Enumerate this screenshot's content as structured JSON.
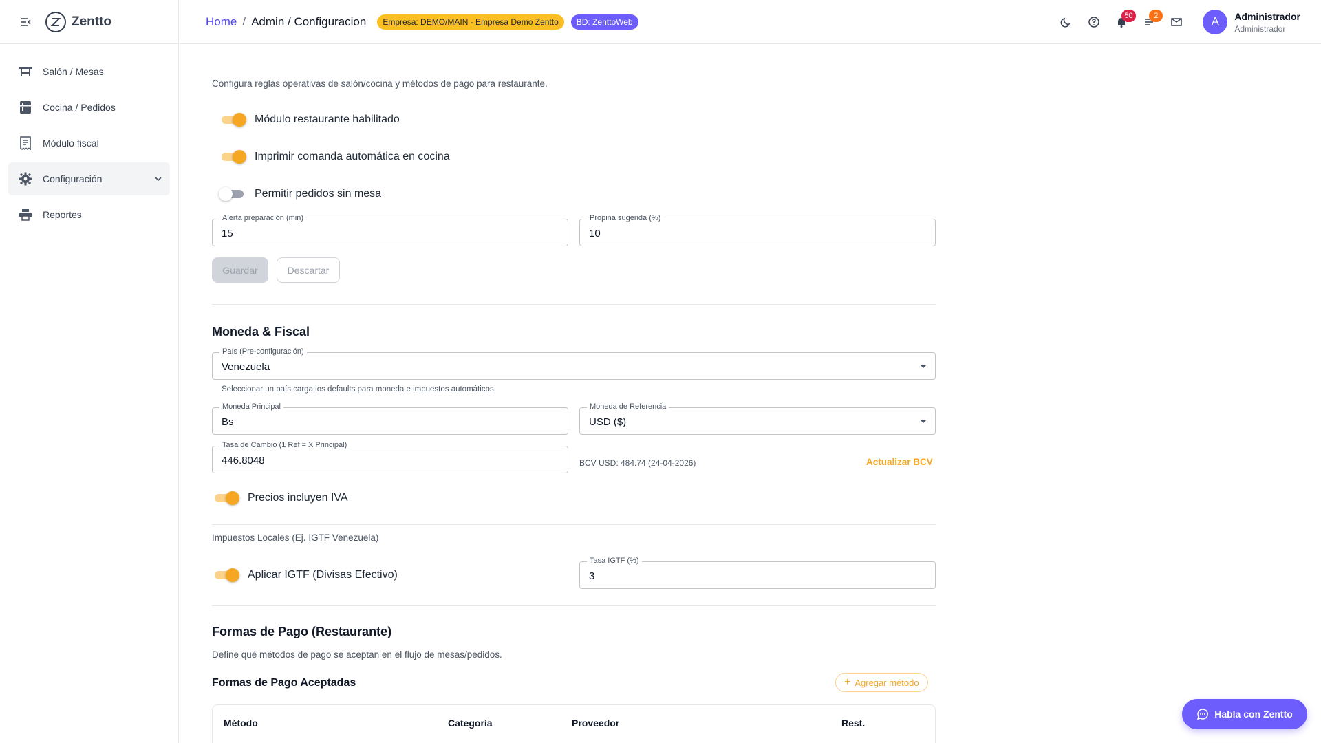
{
  "app": {
    "name": "Zentto"
  },
  "sidebar": {
    "items": [
      {
        "label": "Salón / Mesas",
        "icon": "table-icon"
      },
      {
        "label": "Cocina / Pedidos",
        "icon": "kitchen-icon"
      },
      {
        "label": "Módulo fiscal",
        "icon": "receipt-icon"
      },
      {
        "label": "Configuración",
        "icon": "gear-icon"
      },
      {
        "label": "Reportes",
        "icon": "printer-icon"
      }
    ]
  },
  "breadcrumb": {
    "home": "Home",
    "sep": "/",
    "current": "Admin / Configuracion"
  },
  "chips": {
    "empresa": "Empresa: DEMO/MAIN - Empresa Demo Zentto",
    "bd": "BD: ZenttoWeb"
  },
  "topbar": {
    "notifications_count": "50",
    "tasks_count": "2",
    "user_initial": "A",
    "user_name": "Administrador",
    "user_role": "Administrador"
  },
  "config": {
    "intro": "Configura reglas operativas de salón/cocina y métodos de pago para restaurante.",
    "toggles": [
      {
        "label": "Módulo restaurante habilitado",
        "on": true
      },
      {
        "label": "Imprimir comanda automática en cocina",
        "on": true
      },
      {
        "label": "Permitir pedidos sin mesa",
        "on": false
      }
    ],
    "alert_label": "Alerta preparación (min)",
    "alert_value": "15",
    "tip_label": "Propina sugerida (%)",
    "tip_value": "10",
    "save": "Guardar",
    "discard": "Descartar"
  },
  "moneda": {
    "title": "Moneda & Fiscal",
    "pais_label": "País (Pre-configuración)",
    "pais_value": "Venezuela",
    "pais_helper": "Seleccionar un país carga los defaults para moneda e impuestos automáticos.",
    "principal_label": "Moneda Principal",
    "principal_value": "Bs",
    "ref_label": "Moneda de Referencia",
    "ref_value": "USD ($)",
    "tasa_label": "Tasa de Cambio (1 Ref = X Principal)",
    "tasa_value": "446.8048",
    "bcv_text": "BCV USD: 484.74 (24-04-2026)",
    "bcv_link": "Actualizar BCV",
    "iva_label": "Precios incluyen IVA",
    "iva_on": true,
    "impuestos_label": "Impuestos Locales (Ej. IGTF Venezuela)",
    "igtf_label": "Aplicar IGTF (Divisas Efectivo)",
    "igtf_on": true,
    "igtf_rate_label": "Tasa IGTF (%)",
    "igtf_rate_value": "3"
  },
  "pagos": {
    "title": "Formas de Pago (Restaurante)",
    "desc": "Define qué métodos de pago se aceptan en el flujo de mesas/pedidos.",
    "subtitle": "Formas de Pago Aceptadas",
    "add": "Agregar método",
    "columns": [
      "Método",
      "Categoría",
      "Proveedor",
      "Rest."
    ]
  },
  "chat": {
    "label": "Habla con Zentto"
  },
  "colors": {
    "accent": "#f5a623",
    "brand": "#6d5dfc",
    "link": "#4f46e5"
  }
}
